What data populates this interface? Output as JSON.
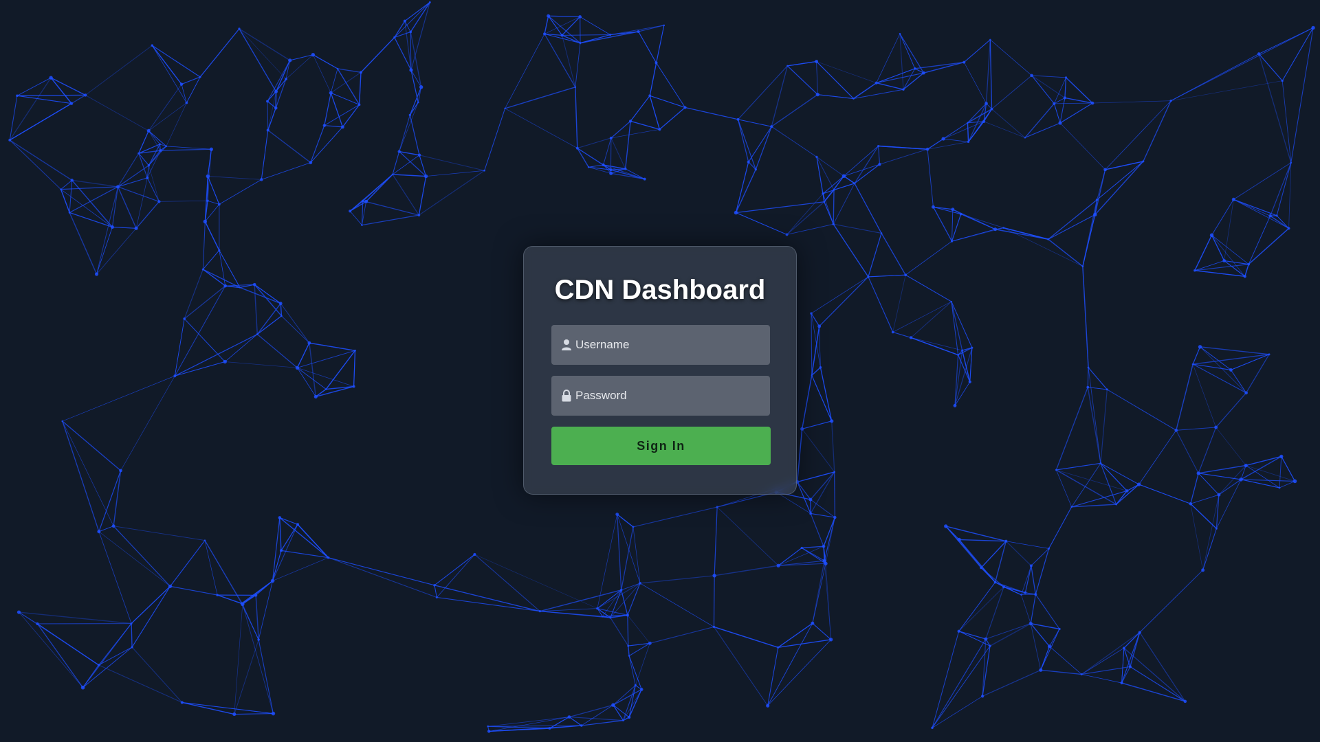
{
  "login": {
    "title": "CDN Dashboard",
    "username": {
      "placeholder": "Username",
      "value": "",
      "icon": "user-icon"
    },
    "password": {
      "placeholder": "Password",
      "value": "",
      "icon": "lock-icon"
    },
    "submit_label": "Sign In"
  },
  "colors": {
    "background": "#111a28",
    "network_line": "#1e4fff",
    "button": "#4caf50"
  }
}
